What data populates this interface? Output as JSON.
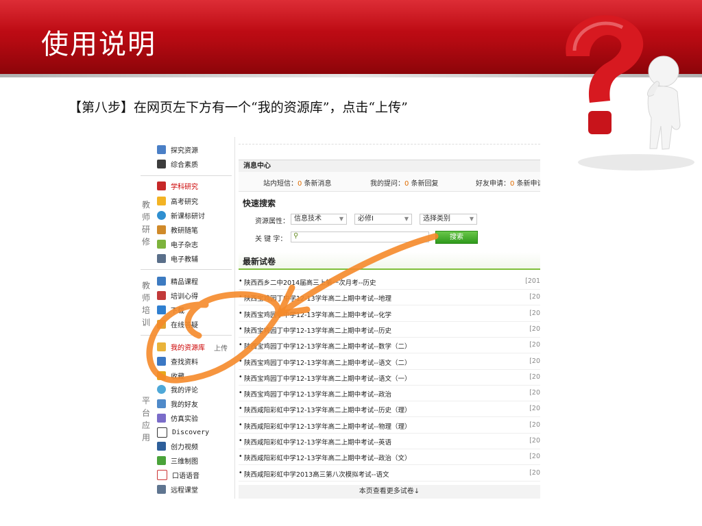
{
  "slide": {
    "title": "使用说明",
    "caption": "【第八步】在网页左下方有一个“我的资源库”，点击“上传”"
  },
  "colors": {
    "banner": "#c00c14",
    "annotation": "#f58a2a",
    "accent_green": "#6fb63a",
    "count_orange": "#e06c00"
  },
  "sidebar": {
    "groups": [
      {
        "label": "教师研修"
      },
      {
        "label": "教师培训"
      },
      {
        "label": "平台应用"
      }
    ],
    "items": [
      {
        "label": "探究资源",
        "icon": "book-icon"
      },
      {
        "label": "综合素质",
        "icon": "grid-icon"
      },
      {
        "label": "学科研究",
        "icon": "books-icon"
      },
      {
        "label": "高考研究",
        "icon": "pencil-icon"
      },
      {
        "label": "新课标研讨",
        "icon": "globe-icon"
      },
      {
        "label": "教研随笔",
        "icon": "notebook-icon"
      },
      {
        "label": "电子杂志",
        "icon": "magazine-icon"
      },
      {
        "label": "电子教辅",
        "icon": "tablet-icon"
      },
      {
        "label": "精品课程",
        "icon": "chart-icon"
      },
      {
        "label": "培训心得",
        "icon": "document-icon"
      },
      {
        "label": "下载",
        "icon": "download-icon"
      },
      {
        "label": "在线答疑",
        "icon": "chat-icon"
      },
      {
        "label": "我的资源库",
        "icon": "folder-icon"
      },
      {
        "label": "查找资料",
        "icon": "search-icon"
      },
      {
        "label": "收藏",
        "icon": "star-icon"
      },
      {
        "label": "我的评论",
        "icon": "comment-icon"
      },
      {
        "label": "我的好友",
        "icon": "friends-icon"
      },
      {
        "label": "仿真实验",
        "icon": "lab-icon"
      },
      {
        "label": "Discovery",
        "icon": "discovery-icon"
      },
      {
        "label": "创力视频",
        "icon": "video-icon"
      },
      {
        "label": "三维制图",
        "icon": "3d-icon"
      },
      {
        "label": "口语语音",
        "icon": "voice-icon"
      },
      {
        "label": "远程课堂",
        "icon": "classroom-icon"
      }
    ],
    "upload_label": "上传"
  },
  "messages": {
    "title": "消息中心",
    "sms_label": "站内短信：",
    "sms_count": "0",
    "sms_suffix": "条新消息",
    "question_label": "我的提问：",
    "question_count": "0",
    "question_suffix": "条新回复",
    "friend_label": "好友申请：",
    "friend_count": "0",
    "friend_suffix": "条新申请"
  },
  "quick_search": {
    "title": "快速搜索",
    "attr_label": "资源属性：",
    "selects": [
      "信息技术",
      "必修Ⅰ",
      "选择类别"
    ],
    "keyword_label": "关 键 字：",
    "search_button": "搜索"
  },
  "latest": {
    "title": "最新试卷",
    "rows": [
      {
        "title": "陕西西乡二中2014届高三上第一次月考--历史",
        "date": "[201"
      },
      {
        "title": "陕西宝鸡园丁中学12-13学年高二上期中考试--地理",
        "date": "[20"
      },
      {
        "title": "陕西宝鸡园丁中学12-13学年高二上期中考试--化学",
        "date": "[20"
      },
      {
        "title": "陕西宝鸡园丁中学12-13学年高二上期中考试--历史",
        "date": "[20"
      },
      {
        "title": "陕西宝鸡园丁中学12-13学年高二上期中考试--数学（二）",
        "date": "[20"
      },
      {
        "title": "陕西宝鸡园丁中学12-13学年高二上期中考试--语文（二）",
        "date": "[20"
      },
      {
        "title": "陕西宝鸡园丁中学12-13学年高二上期中考试--语文（一）",
        "date": "[20"
      },
      {
        "title": "陕西宝鸡园丁中学12-13学年高二上期中考试--政治",
        "date": "[20"
      },
      {
        "title": "陕西咸阳彩虹中学12-13学年高二上期中考试--历史（理）",
        "date": "[20"
      },
      {
        "title": "陕西咸阳彩虹中学12-13学年高二上期中考试--物理（理）",
        "date": "[20"
      },
      {
        "title": "陕西咸阳彩虹中学12-13学年高二上期中考试--英语",
        "date": "[20"
      },
      {
        "title": "陕西咸阳彩虹中学12-13学年高二上期中考试--政治（文）",
        "date": "[20"
      },
      {
        "title": "陕西咸阳彩虹中学2013高三第八次模拟考试--语文",
        "date": "[20"
      }
    ],
    "more_label": "本页查看更多试卷↓"
  }
}
